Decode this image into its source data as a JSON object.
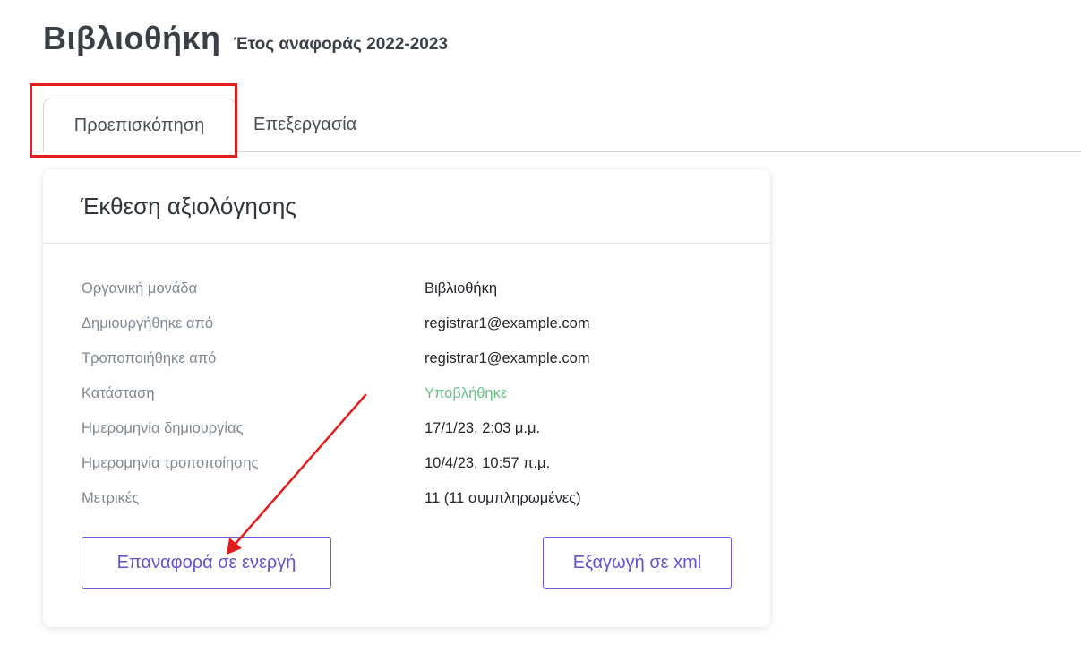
{
  "header": {
    "title": "Βιβλιοθήκη",
    "year_label": "Έτος αναφοράς 2022-2023"
  },
  "tabs": [
    {
      "label": "Προεπισκόπηση",
      "active": true
    },
    {
      "label": "Επεξεργασία",
      "active": false
    }
  ],
  "card": {
    "title": "Έκθεση αξιολόγησης",
    "details": [
      {
        "label": "Οργανική μονάδα",
        "value": "Βιβλιοθήκη"
      },
      {
        "label": "Δημιουργήθηκε από",
        "value": "registrar1@example.com"
      },
      {
        "label": "Τροποποιήθηκε από",
        "value": "registrar1@example.com"
      },
      {
        "label": "Κατάσταση",
        "value": "Υποβλήθηκε"
      },
      {
        "label": "Ημερομηνία δημιουργίας",
        "value": "17/1/23, 2:03 μ.μ."
      },
      {
        "label": "Ημερομηνία τροποποίησης",
        "value": "10/4/23, 10:57 π.μ."
      },
      {
        "label": "Μετρικές",
        "value": "11 (11 συμπληρωμένες)"
      }
    ],
    "buttons": {
      "revert_label": "Επαναφορά σε ενεργή",
      "export_label": "Εξαγωγή σε xml"
    }
  },
  "colors": {
    "accent": "#6352c9",
    "status_submitted": "#6abf86",
    "annotation_red": "#e11d1d"
  }
}
